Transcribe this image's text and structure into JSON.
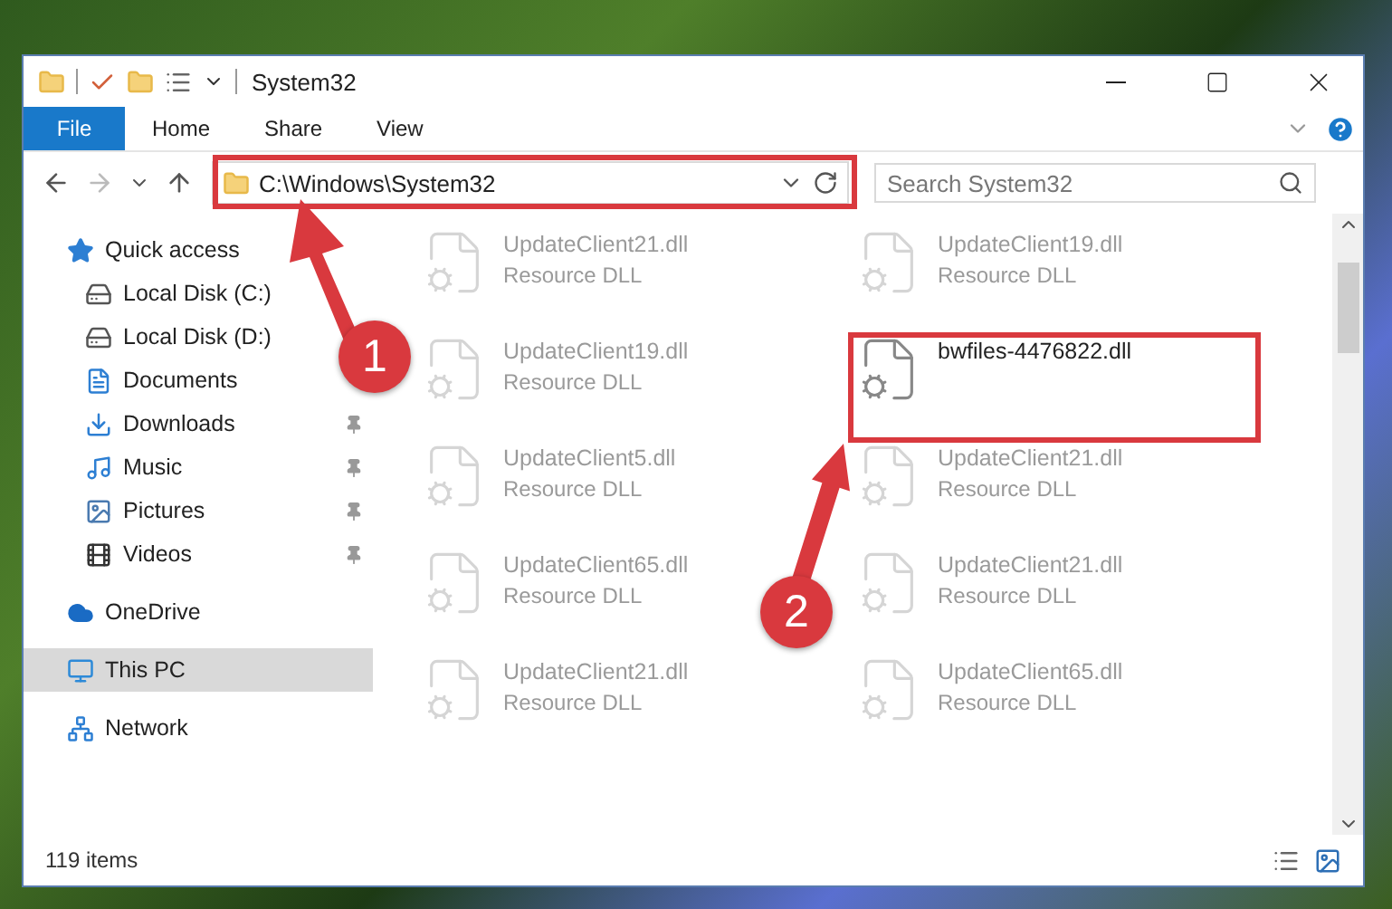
{
  "window": {
    "title": "System32"
  },
  "ribbon_tabs": [
    {
      "label": "File",
      "kind": "menu"
    },
    {
      "label": "Home",
      "kind": "tab"
    },
    {
      "label": "Share",
      "kind": "tab"
    },
    {
      "label": "View",
      "kind": "tab"
    }
  ],
  "navigation": {
    "forward_disabled": true
  },
  "address_bar": {
    "value": "C:\\Windows\\System32"
  },
  "search": {
    "placeholder": "Search System32"
  },
  "sidebar": {
    "items": [
      {
        "label": "Quick access",
        "selected": false,
        "children": [
          {
            "label": "Local Disk (C:)",
            "pinned": false,
            "selected": false
          },
          {
            "label": "Local Disk (D:)",
            "pinned": false,
            "selected": false
          },
          {
            "label": "Documents",
            "pinned": false,
            "selected": false
          },
          {
            "label": "Downloads",
            "pinned": true,
            "selected": false
          },
          {
            "label": "Music",
            "pinned": true,
            "selected": false
          },
          {
            "label": "Pictures",
            "pinned": true,
            "selected": false
          },
          {
            "label": "Videos",
            "pinned": true,
            "selected": false
          }
        ]
      },
      {
        "label": "OneDrive",
        "selected": false
      },
      {
        "label": "This PC",
        "selected": true
      },
      {
        "label": "Network",
        "selected": false
      }
    ]
  },
  "files": [
    {
      "name": "UpdateClient21.dll",
      "type": "Resource DLL",
      "kind": "blurred"
    },
    {
      "name": "UpdateClient19.dll",
      "type": "Resource DLL",
      "kind": "blurred"
    },
    {
      "name": "UpdateClient19.dll",
      "type": "Resource DLL",
      "kind": "blurred"
    },
    {
      "name": "bwfiles-4476822.dll",
      "kind": "plain"
    },
    {
      "name": "UpdateClient5.dll",
      "type": "Resource DLL",
      "kind": "blurred"
    },
    {
      "name": "UpdateClient21.dll",
      "type": "Resource DLL",
      "kind": "blurred"
    },
    {
      "name": "UpdateClient65.dll",
      "type": "Resource DLL",
      "kind": "blurred"
    },
    {
      "name": "UpdateClient21.dll",
      "type": "Resource DLL",
      "kind": "blurred"
    },
    {
      "name": "UpdateClient21.dll",
      "type": "Resource DLL",
      "kind": "blurred"
    },
    {
      "name": "UpdateClient65.dll",
      "type": "Resource DLL",
      "kind": "blurred"
    }
  ],
  "status_bar": {
    "item_count": "119 items"
  },
  "callouts": [
    {
      "number": "1"
    },
    {
      "number": "2"
    }
  ]
}
